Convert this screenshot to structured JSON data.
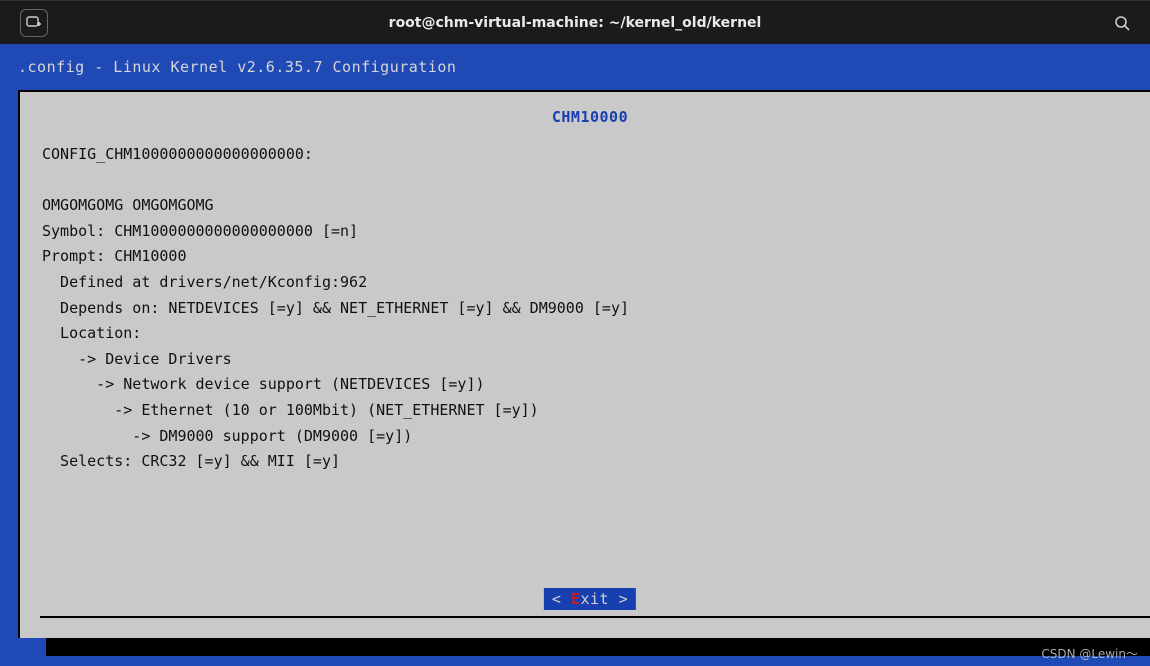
{
  "titlebar": {
    "title": "root@chm-virtual-machine: ~/kernel_old/kernel"
  },
  "config_header": ".config - Linux Kernel v2.6.35.7 Configuration",
  "panel": {
    "title": "CHM10000",
    "lines": {
      "l0": "CONFIG_CHM1000000000000000000:",
      "l1": "",
      "l2": "OMGOMGOMG OMGOMGOMG",
      "l3": "Symbol: CHM1000000000000000000 [=n]",
      "l4": "Prompt: CHM10000",
      "l5": "  Defined at drivers/net/Kconfig:962",
      "l6": "  Depends on: NETDEVICES [=y] && NET_ETHERNET [=y] && DM9000 [=y]",
      "l7": "  Location:",
      "l8": "    -> Device Drivers",
      "l9": "      -> Network device support (NETDEVICES [=y])",
      "l10": "        -> Ethernet (10 or 100Mbit) (NET_ETHERNET [=y])",
      "l11": "          -> DM9000 support (DM9000 [=y])",
      "l12": "  Selects: CRC32 [=y] && MII [=y]"
    }
  },
  "exit_button": {
    "prefix": "< ",
    "hotkey": "E",
    "suffix": "xit >"
  },
  "watermark": "CSDN @Lewin～"
}
